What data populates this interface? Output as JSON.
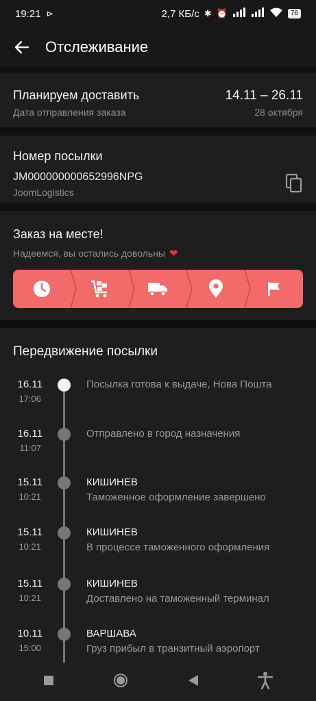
{
  "status_bar": {
    "time": "19:21",
    "network_speed": "2,7 КБ/с",
    "battery": "76"
  },
  "app_bar": {
    "title": "Отслеживание"
  },
  "delivery": {
    "label": "Планируем доставить",
    "sub_label": "Дата отправления заказа",
    "date_range": "14.11 – 26.11",
    "ship_date": "28 октября"
  },
  "parcel": {
    "label": "Номер посылки",
    "number": "JM000000000652996NPG",
    "carrier": "JoomLogistics"
  },
  "order_status": {
    "title": "Заказ на месте!",
    "subtitle": "Надеемся, вы остались довольны",
    "steps": [
      "clock-icon",
      "cart-icon",
      "truck-icon",
      "location-pin-icon",
      "flag-icon"
    ],
    "accent_color": "#f26a6a"
  },
  "movement": {
    "title": "Передвижение посылки",
    "events": [
      {
        "date": "16.11",
        "time": "17:06",
        "location": "",
        "text": "Посылка готова к выдаче, Нова Пошта"
      },
      {
        "date": "16.11",
        "time": "11:07",
        "location": "",
        "text": "Отправлено в город назначения"
      },
      {
        "date": "15.11",
        "time": "10:21",
        "location": "КИШИНЕВ",
        "text": "Таможенное оформление завершено"
      },
      {
        "date": "15.11",
        "time": "10:21",
        "location": "КИШИНЕВ",
        "text": "В процессе таможенного оформления"
      },
      {
        "date": "15.11",
        "time": "10:21",
        "location": "КИШИНЕВ",
        "text": "Доставлено на таможенный терминал"
      },
      {
        "date": "10.11",
        "time": "15:00",
        "location": "ВАРШАВА",
        "text": "Груз прибыл в транзитный аэропорт"
      }
    ]
  }
}
